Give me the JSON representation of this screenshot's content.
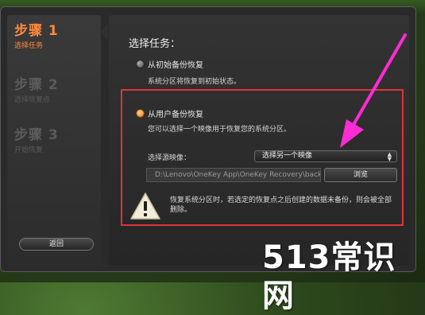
{
  "steps": [
    {
      "title": "步骤 1",
      "subtitle": "选择任务",
      "state": "active"
    },
    {
      "title": "步骤 2",
      "subtitle": "选择恢复点",
      "state": "inactive"
    },
    {
      "title": "步骤 3",
      "subtitle": "开始恢复",
      "state": "inactive"
    }
  ],
  "main": {
    "heading": "选择任务：",
    "options": [
      {
        "label": "从初始备份恢复",
        "description": "系统分区将恢复到初始状态。",
        "selected": false
      },
      {
        "label": "从用户备份恢复",
        "description": "您可以选择一个映像用于恢复您的系统分区。",
        "selected": true
      }
    ],
    "source_image_label": "选择源映像：",
    "source_select_value": "选择另一个映像",
    "path_value": "D:\\Lenovo\\OneKey App\\OneKey Recovery\\backu",
    "browse_label": "浏览",
    "warning_text": "恢复系统分区时，若选定的恢复点之后创建的数据未备份，则会被全部删除。"
  },
  "footer": {
    "back_label": "返回"
  },
  "watermark": "513常识网",
  "colors": {
    "accent": "#ff8a3c",
    "highlight_box": "#e0343b",
    "annotation_arrow": "#ff2bd4",
    "warning_icon": "#f3ecd8"
  }
}
